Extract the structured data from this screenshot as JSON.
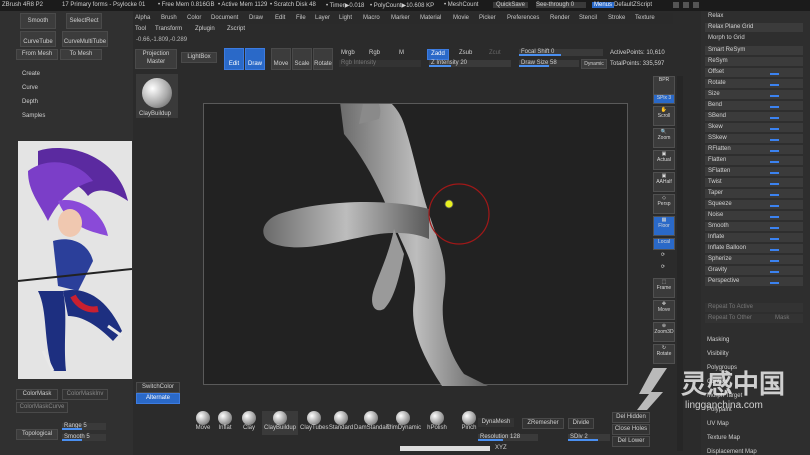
{
  "topbar": {
    "app_title": "ZBrush 4R8 P2",
    "doc": "17 Primary forms - Psylocke 01",
    "free_mem": "• Free Mem 0.816GB",
    "active_mem": "• Active Mem 1129",
    "scratch": "• Scratch Disk 48",
    "timer": "• Timer▶0.018",
    "polycount": "• PolyCount▶10.608 KP",
    "meshcount": "• MeshCount",
    "quicksave": "QuickSave",
    "seethrough": "See-through",
    "seethrough_val": "0",
    "menus_btn": "Menus",
    "script": "DefaultZScript"
  },
  "menubar": [
    "Alpha",
    "Brush",
    "Color",
    "Document",
    "Draw",
    "Edit",
    "File",
    "Layer",
    "Light",
    "Macro",
    "Marker",
    "Material",
    "Movie",
    "Picker",
    "Preferences",
    "Render",
    "Stencil",
    "Stroke",
    "Texture"
  ],
  "menubar2": [
    "Tool",
    "Transform",
    "Zplugin",
    "Zscript"
  ],
  "coords": "-0.66,-1.809,-0.289",
  "left": {
    "smooth": "Smooth",
    "selectrect": "SelectRect",
    "curvetube": "CurveTube",
    "curvemultitube": "CurveMultiTube",
    "from_mesh": "From Mesh",
    "to_mesh": "To Mesh",
    "create": "Create",
    "curve": "Curve",
    "depth": "Depth",
    "samples": "Samples",
    "colormask": "ColorMask",
    "colormaskinv": "ColorMaskInv",
    "colormaskcurve": "ColorMaskCurve",
    "topological": "Topological",
    "range": "Range 5",
    "smooth5": "Smooth 5"
  },
  "toolbar": {
    "projection_master": "Projection Master",
    "lightbox": "LightBox",
    "edit": "Edit",
    "draw": "Draw",
    "move": "Move",
    "scale": "Scale",
    "rotate": "Rotate",
    "mrgb": "Mrgb",
    "rgb": "Rgb",
    "m": "M",
    "zadd": "Zadd",
    "zsub": "Zsub",
    "zcut": "Zcut",
    "rgb_intensity": "Rgb Intensity",
    "z_intensity": "Z Intensity 20",
    "focal_shift": "Focal Shift 0",
    "draw_size": "Draw Size 58",
    "dynamic": "Dynamic",
    "active_points": "ActivePoints: 10,610",
    "total_points": "TotalPoints: 335,597"
  },
  "left_col": {
    "clay_buildup": "ClayBuildup",
    "switch_color": "SwitchColor",
    "alternate": "Alternate"
  },
  "right_tools": [
    "BPR",
    "SPix 3",
    "Scroll",
    "Zoom",
    "Actual",
    "AAHalf",
    "Persp",
    "Floor",
    "Local",
    "",
    "",
    "Frame",
    "Move",
    "Zoom3D",
    "Rotate"
  ],
  "right_panel": {
    "top": [
      "Relax",
      "Relax Plane Grid",
      "Morph to Grid"
    ],
    "smart_resym": "Smart ReSym",
    "resym": "ReSym",
    "deformers": [
      "Offset",
      "Rotate",
      "Size",
      "Bend",
      "SBend",
      "Skew",
      "SSkew",
      "RFlatten",
      "Flatten",
      "SFlatten",
      "Twist",
      "Taper",
      "Squeeze",
      "Noise",
      "Smooth",
      "Inflate",
      "Inflate Balloon",
      "Spherize",
      "Gravity",
      "Perspective"
    ],
    "repeat_active": "Repeat To Active",
    "repeat_other": "Repeat To Other",
    "mask": "Mask",
    "sections": [
      "Masking",
      "Visibility",
      "Polygroups",
      "Contact",
      "Morph Target",
      "Polypaint",
      "UV Map",
      "Texture Map",
      "Displacement Map"
    ]
  },
  "brushes": [
    "Move",
    "Inflat",
    "Clay",
    "ClayBuildup",
    "ClayTubes",
    "Standard",
    "DamStandard",
    "hPolish",
    "TrimDynamic",
    "Pinch"
  ],
  "bottom": {
    "dynamesh": "DynaMesh",
    "resolution": "Resolution 128",
    "zremesher": "ZRemesher",
    "divide": "Divide",
    "sdiv": "SDiv 2",
    "del_hidden": "Del Hidden",
    "close_holes": "Close Holes",
    "del_lower": "Del Lower",
    "xyz": "XYZ"
  },
  "watermark": {
    "cn": "灵感中国",
    "url": "lingganchina.com"
  }
}
